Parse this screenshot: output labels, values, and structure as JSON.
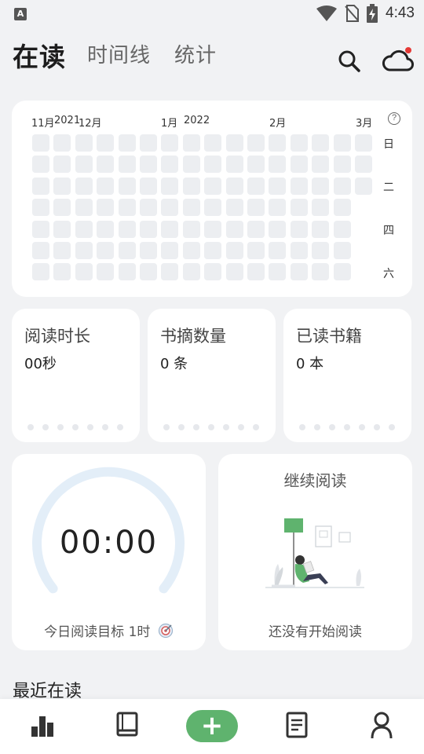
{
  "status_bar": {
    "app_icon_letter": "A",
    "time": "4:43"
  },
  "header": {
    "tabs": [
      {
        "label": "在读",
        "active": true
      },
      {
        "label": "时间线",
        "active": false
      },
      {
        "label": "统计",
        "active": false
      }
    ]
  },
  "heatmap": {
    "months": [
      "11月",
      "2021",
      "12月",
      "1月",
      "2022",
      "2月",
      "3月"
    ],
    "weekday_labels": [
      "日",
      "二",
      "四",
      "六"
    ],
    "help_label": "?",
    "columns": 16,
    "last_column_filled_rows": 3
  },
  "stats": [
    {
      "title": "阅读时长",
      "value": "00秒"
    },
    {
      "title": "书摘数量",
      "value": "0 条"
    },
    {
      "title": "已读书籍",
      "value": "0 本"
    }
  ],
  "timer": {
    "display": "00:00",
    "goal": "今日阅读目标 1时"
  },
  "continue_reading": {
    "title": "继续阅读",
    "empty_text": "还没有开始阅读"
  },
  "recent": {
    "title": "最近在读"
  },
  "bottom_nav": {
    "items": [
      "stats-icon",
      "book-icon",
      "add-icon",
      "notes-icon",
      "profile-icon"
    ],
    "add_label": "+"
  },
  "colors": {
    "accent": "#5fb36e",
    "cell": "#eceef1",
    "arc": "#e3eef8",
    "notification_dot": "#e53935"
  }
}
